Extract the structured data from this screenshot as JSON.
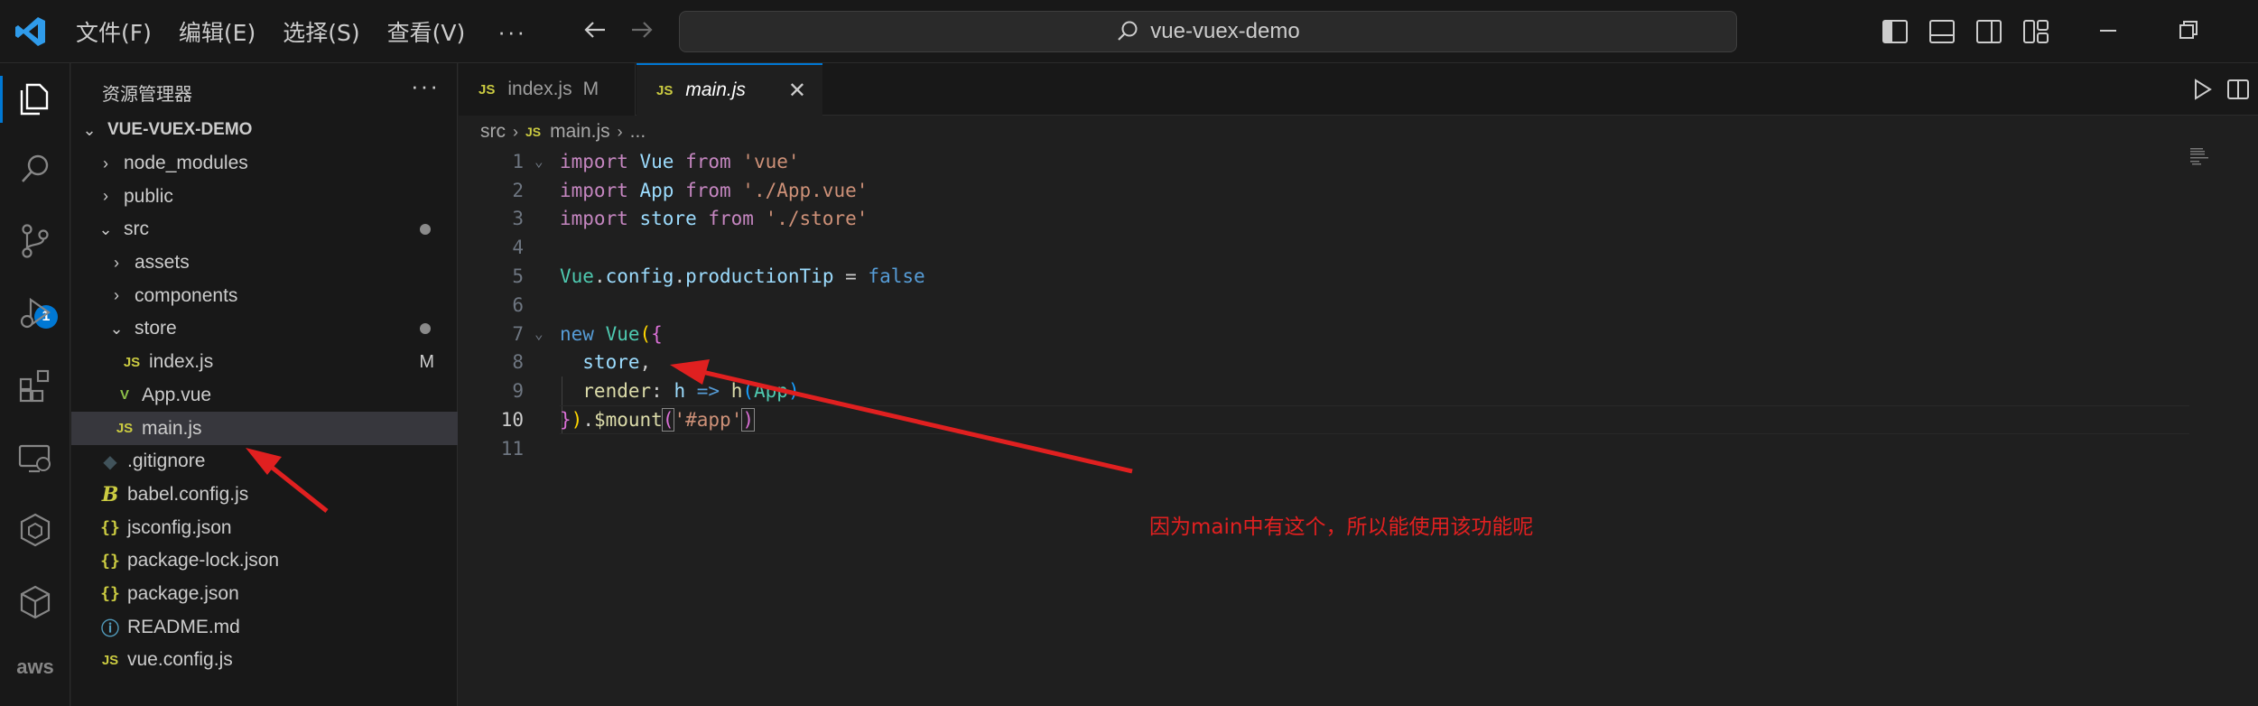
{
  "titlebar": {
    "menus": [
      "文件(F)",
      "编辑(E)",
      "选择(S)",
      "查看(V)"
    ],
    "more": "···",
    "search_text": "vue-vuex-demo",
    "icons": [
      "back-arrow-icon",
      "forward-arrow-icon",
      "toggle-primary-sidebar-icon",
      "toggle-panel-icon",
      "toggle-secondary-sidebar-icon",
      "customize-layout-icon",
      "minimize-icon",
      "restore-icon"
    ]
  },
  "activitybar": {
    "items": [
      "explorer-icon",
      "search-icon",
      "source-control-icon",
      "run-debug-icon",
      "extensions-icon",
      "remote-explorer-icon",
      "openai-icon",
      "package-icon",
      "aws-icon"
    ],
    "source_control_badge": "1",
    "aws_label": "aws"
  },
  "sidebar": {
    "title": "资源管理器",
    "more": "···",
    "root": "VUE-VUEX-DEMO",
    "items": [
      {
        "label": "node_modules",
        "chevron": "›"
      },
      {
        "label": "public",
        "chevron": "›"
      },
      {
        "label": "src",
        "chevron": "⌄"
      },
      {
        "label": "assets",
        "chevron": "›"
      },
      {
        "label": "components",
        "chevron": "›"
      },
      {
        "label": "store",
        "chevron": "⌄"
      },
      {
        "label": "index.js",
        "icon": "JS",
        "status": "M"
      },
      {
        "label": "App.vue",
        "icon": "V"
      },
      {
        "label": "main.js",
        "icon": "JS"
      },
      {
        "label": ".gitignore",
        "icon": "◆"
      },
      {
        "label": "babel.config.js",
        "icon": "B"
      },
      {
        "label": "jsconfig.json",
        "icon": "{}"
      },
      {
        "label": "package-lock.json",
        "icon": "{}"
      },
      {
        "label": "package.json",
        "icon": "{}"
      },
      {
        "label": "README.md",
        "icon": "ⓘ"
      },
      {
        "label": "vue.config.js",
        "icon": "JS"
      }
    ]
  },
  "tabs": [
    {
      "label": "index.js",
      "icon": "JS",
      "status": "M"
    },
    {
      "label": "main.js",
      "icon": "JS",
      "close": "✕"
    }
  ],
  "breadcrumb": {
    "folder": "src",
    "file_icon": "JS",
    "file": "main.js",
    "ellipsis": "..."
  },
  "code": {
    "line_numbers": [
      "1",
      "2",
      "3",
      "4",
      "5",
      "6",
      "7",
      "8",
      "9",
      "10",
      "11"
    ],
    "l1": {
      "a": "import",
      "b": " Vue ",
      "c": "from",
      "d": " 'vue'"
    },
    "l2": {
      "a": "import",
      "b": " App ",
      "c": "from",
      "d": " './App.vue'"
    },
    "l3": {
      "a": "import",
      "b": " store ",
      "c": "from",
      "d": " './store'"
    },
    "l5": {
      "a": "Vue",
      "b": ".",
      "c": "config",
      "d": ".",
      "e": "productionTip",
      "f": " = ",
      "g": "false"
    },
    "l7": {
      "a": "new",
      "b": " Vue",
      "c": "(",
      "d": "{"
    },
    "l8": {
      "a": "  store",
      "b": ","
    },
    "l9": {
      "a": "  render",
      "b": ": ",
      "c": "h",
      "d": " => ",
      "e": "h",
      "f": "(",
      "g": "App",
      "h": ")"
    },
    "l10": {
      "a": "}",
      "b": ")",
      "c": ".",
      "d": "$mount",
      "e": "(",
      "f": "'#app'",
      "g": ")"
    }
  },
  "annotation": {
    "text": "因为main中有这个，所以能使用该功能呢",
    "color": "#e02020"
  },
  "colors": {
    "accent": "#0078d4",
    "js_icon": "#cbcb41",
    "vue_icon": "#8dc149"
  }
}
